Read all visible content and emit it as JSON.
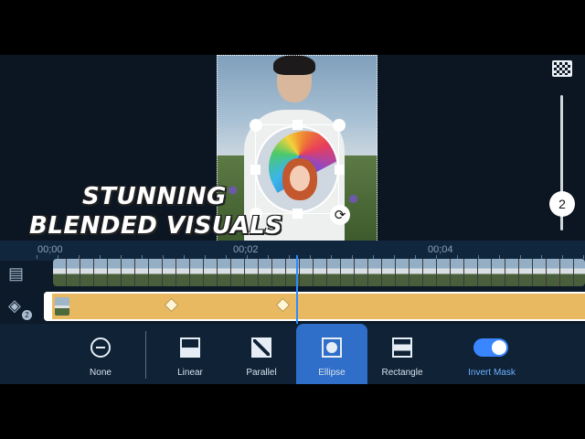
{
  "caption": {
    "line1": "STUNNING",
    "line2": "BLENDED VISUALS"
  },
  "right_panel": {
    "checker_icon": "checkerboard-icon",
    "slider_value": "2"
  },
  "timeline": {
    "time_labels": [
      "00;00",
      "00;02",
      "00;04"
    ],
    "layer_badge": "2",
    "playhead_color": "#2b8cff",
    "clip_color": "#e9b962"
  },
  "toolbar": {
    "items": [
      {
        "label": "None",
        "icon": "none-icon"
      },
      {
        "label": "Linear",
        "icon": "linear-icon"
      },
      {
        "label": "Parallel",
        "icon": "parallel-icon"
      },
      {
        "label": "Ellipse",
        "icon": "ellipse-icon",
        "selected": true
      },
      {
        "label": "Rectangle",
        "icon": "rectangle-icon"
      }
    ],
    "invert_mask": {
      "label": "Invert Mask",
      "on": true
    },
    "accent": "#2f6fc9"
  }
}
